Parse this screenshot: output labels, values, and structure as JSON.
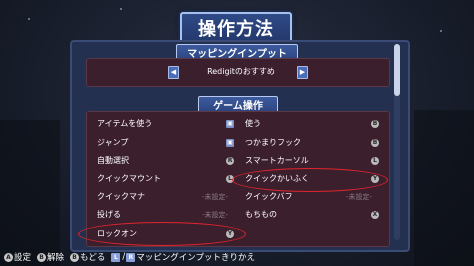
{
  "screen_title": "操作方法",
  "preset_section": {
    "title": "マッピングインプット",
    "preset_name": "Redigitのおすすめ",
    "prev_arrow": "◀",
    "next_arrow": "▶"
  },
  "game_section": {
    "title": "ゲーム操作",
    "left_rows": [
      {
        "label": "アイテムを使う",
        "glyph": "",
        "glyph_icon": "dpad-square-icon",
        "unset": ""
      },
      {
        "label": "ジャンプ",
        "glyph": "",
        "glyph_icon": "dpad-square-icon",
        "unset": ""
      },
      {
        "label": "自動選択",
        "glyph": "R",
        "glyph_icon": "r-button-icon",
        "unset": ""
      },
      {
        "label": "クイックマウント",
        "glyph": "L",
        "glyph_icon": "l-button-icon",
        "unset": ""
      },
      {
        "label": "クイックマナ",
        "glyph": "",
        "glyph_icon": "",
        "unset": "-未設定-"
      },
      {
        "label": "投げる",
        "glyph": "",
        "glyph_icon": "",
        "unset": "-未設定-"
      },
      {
        "label": "ロックオン",
        "glyph": "Y",
        "glyph_icon": "y-button-icon",
        "unset": ""
      }
    ],
    "right_rows": [
      {
        "label": "使う",
        "glyph": "B",
        "glyph_icon": "b-button-icon",
        "unset": ""
      },
      {
        "label": "つかまりフック",
        "glyph": "B",
        "glyph_icon": "b-button-icon",
        "unset": ""
      },
      {
        "label": "スマートカーソル",
        "glyph": "L",
        "glyph_icon": "l-button-icon",
        "unset": ""
      },
      {
        "label": "クイックかいふく",
        "glyph": "Y",
        "glyph_icon": "y-button-icon",
        "unset": ""
      },
      {
        "label": "クイックバフ",
        "glyph": "",
        "glyph_icon": "",
        "unset": "-未設定-"
      },
      {
        "label": "もちもの",
        "glyph": "X",
        "glyph_icon": "x-button-icon",
        "unset": ""
      }
    ]
  },
  "footer": {
    "items": [
      {
        "glyph": "A",
        "label": "設定"
      },
      {
        "glyph": "B",
        "label": "解除"
      },
      {
        "glyph": "B",
        "label": "もどる"
      },
      {
        "glyph": "L",
        "glyph2": "R",
        "label": "マッピングインプットきりかえ"
      }
    ]
  },
  "colors": {
    "highlight_oval": "#e2242f",
    "panel": "#23304f",
    "list_bg": "#3b1f2d"
  }
}
